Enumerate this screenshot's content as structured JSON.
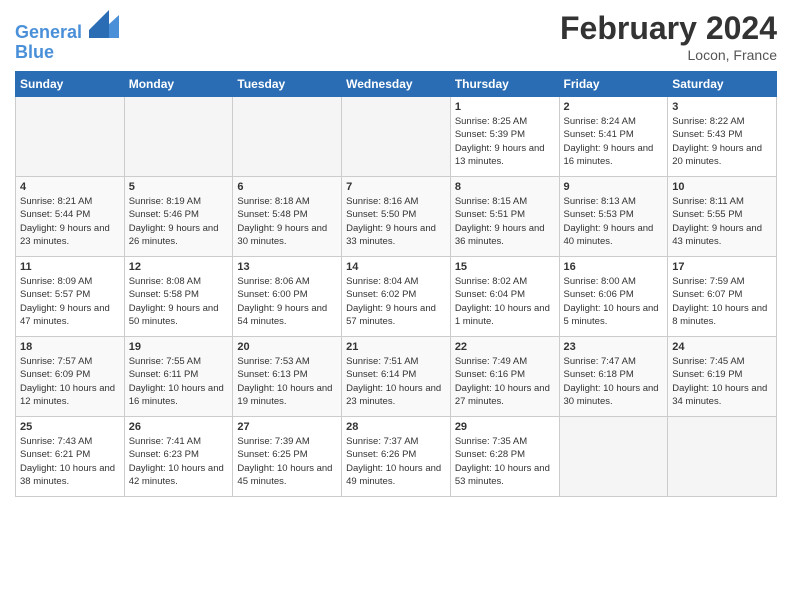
{
  "header": {
    "logo_line1": "General",
    "logo_line2": "Blue",
    "month_title": "February 2024",
    "location": "Locon, France"
  },
  "days_of_week": [
    "Sunday",
    "Monday",
    "Tuesday",
    "Wednesday",
    "Thursday",
    "Friday",
    "Saturday"
  ],
  "weeks": [
    [
      {
        "day": "",
        "info": ""
      },
      {
        "day": "",
        "info": ""
      },
      {
        "day": "",
        "info": ""
      },
      {
        "day": "",
        "info": ""
      },
      {
        "day": "1",
        "info": "Sunrise: 8:25 AM\nSunset: 5:39 PM\nDaylight: 9 hours\nand 13 minutes."
      },
      {
        "day": "2",
        "info": "Sunrise: 8:24 AM\nSunset: 5:41 PM\nDaylight: 9 hours\nand 16 minutes."
      },
      {
        "day": "3",
        "info": "Sunrise: 8:22 AM\nSunset: 5:43 PM\nDaylight: 9 hours\nand 20 minutes."
      }
    ],
    [
      {
        "day": "4",
        "info": "Sunrise: 8:21 AM\nSunset: 5:44 PM\nDaylight: 9 hours\nand 23 minutes."
      },
      {
        "day": "5",
        "info": "Sunrise: 8:19 AM\nSunset: 5:46 PM\nDaylight: 9 hours\nand 26 minutes."
      },
      {
        "day": "6",
        "info": "Sunrise: 8:18 AM\nSunset: 5:48 PM\nDaylight: 9 hours\nand 30 minutes."
      },
      {
        "day": "7",
        "info": "Sunrise: 8:16 AM\nSunset: 5:50 PM\nDaylight: 9 hours\nand 33 minutes."
      },
      {
        "day": "8",
        "info": "Sunrise: 8:15 AM\nSunset: 5:51 PM\nDaylight: 9 hours\nand 36 minutes."
      },
      {
        "day": "9",
        "info": "Sunrise: 8:13 AM\nSunset: 5:53 PM\nDaylight: 9 hours\nand 40 minutes."
      },
      {
        "day": "10",
        "info": "Sunrise: 8:11 AM\nSunset: 5:55 PM\nDaylight: 9 hours\nand 43 minutes."
      }
    ],
    [
      {
        "day": "11",
        "info": "Sunrise: 8:09 AM\nSunset: 5:57 PM\nDaylight: 9 hours\nand 47 minutes."
      },
      {
        "day": "12",
        "info": "Sunrise: 8:08 AM\nSunset: 5:58 PM\nDaylight: 9 hours\nand 50 minutes."
      },
      {
        "day": "13",
        "info": "Sunrise: 8:06 AM\nSunset: 6:00 PM\nDaylight: 9 hours\nand 54 minutes."
      },
      {
        "day": "14",
        "info": "Sunrise: 8:04 AM\nSunset: 6:02 PM\nDaylight: 9 hours\nand 57 minutes."
      },
      {
        "day": "15",
        "info": "Sunrise: 8:02 AM\nSunset: 6:04 PM\nDaylight: 10 hours\nand 1 minute."
      },
      {
        "day": "16",
        "info": "Sunrise: 8:00 AM\nSunset: 6:06 PM\nDaylight: 10 hours\nand 5 minutes."
      },
      {
        "day": "17",
        "info": "Sunrise: 7:59 AM\nSunset: 6:07 PM\nDaylight: 10 hours\nand 8 minutes."
      }
    ],
    [
      {
        "day": "18",
        "info": "Sunrise: 7:57 AM\nSunset: 6:09 PM\nDaylight: 10 hours\nand 12 minutes."
      },
      {
        "day": "19",
        "info": "Sunrise: 7:55 AM\nSunset: 6:11 PM\nDaylight: 10 hours\nand 16 minutes."
      },
      {
        "day": "20",
        "info": "Sunrise: 7:53 AM\nSunset: 6:13 PM\nDaylight: 10 hours\nand 19 minutes."
      },
      {
        "day": "21",
        "info": "Sunrise: 7:51 AM\nSunset: 6:14 PM\nDaylight: 10 hours\nand 23 minutes."
      },
      {
        "day": "22",
        "info": "Sunrise: 7:49 AM\nSunset: 6:16 PM\nDaylight: 10 hours\nand 27 minutes."
      },
      {
        "day": "23",
        "info": "Sunrise: 7:47 AM\nSunset: 6:18 PM\nDaylight: 10 hours\nand 30 minutes."
      },
      {
        "day": "24",
        "info": "Sunrise: 7:45 AM\nSunset: 6:19 PM\nDaylight: 10 hours\nand 34 minutes."
      }
    ],
    [
      {
        "day": "25",
        "info": "Sunrise: 7:43 AM\nSunset: 6:21 PM\nDaylight: 10 hours\nand 38 minutes."
      },
      {
        "day": "26",
        "info": "Sunrise: 7:41 AM\nSunset: 6:23 PM\nDaylight: 10 hours\nand 42 minutes."
      },
      {
        "day": "27",
        "info": "Sunrise: 7:39 AM\nSunset: 6:25 PM\nDaylight: 10 hours\nand 45 minutes."
      },
      {
        "day": "28",
        "info": "Sunrise: 7:37 AM\nSunset: 6:26 PM\nDaylight: 10 hours\nand 49 minutes."
      },
      {
        "day": "29",
        "info": "Sunrise: 7:35 AM\nSunset: 6:28 PM\nDaylight: 10 hours\nand 53 minutes."
      },
      {
        "day": "",
        "info": ""
      },
      {
        "day": "",
        "info": ""
      }
    ]
  ]
}
